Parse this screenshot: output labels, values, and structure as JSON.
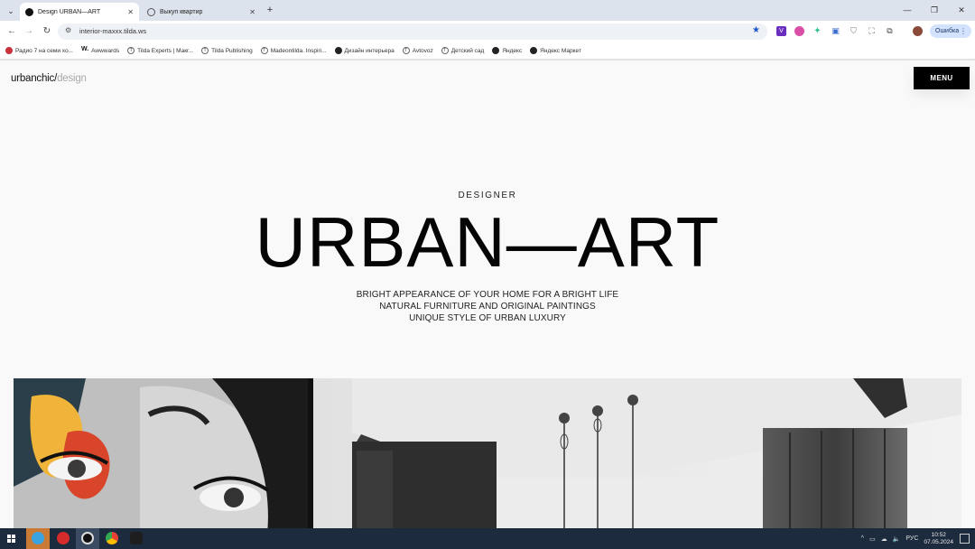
{
  "browser": {
    "tabs": [
      {
        "label": "Design URBAN—ART",
        "active": true
      },
      {
        "label": "Выкуп квартир",
        "active": false
      }
    ],
    "tab_list_icon": "chevron-down-icon",
    "new_tab_label": "+",
    "window_controls": {
      "minimize": "—",
      "restore": "❐",
      "close": "✕"
    },
    "nav": {
      "back": "←",
      "forward": "→",
      "reload": "↻"
    },
    "url": "interior-maxxx.tilda.ws",
    "error_label": "Ошибка",
    "bookmarks": [
      "Радио 7 на семи хо...",
      "Awwwards",
      "Tilda Experts | Макг...",
      "Tilda Publishing",
      "Madeontilda. Inspiri...",
      "Дизайн интерьера",
      "Avtovoz",
      "Детский сад",
      "Яндекс",
      "Яндекс Маркет"
    ]
  },
  "site": {
    "logo_main": "urbanchic/",
    "logo_sub": "design",
    "menu_label": "MENU",
    "eyebrow": "DESIGNER",
    "title": "URBAN—ART",
    "tagline": [
      "BRIGHT APPEARANCE OF YOUR HOME FOR A BRIGHT LIFE",
      "NATURAL FURNITURE AND ORIGINAL PAINTINGS",
      "UNIQUE STYLE OF URBAN LUXURY"
    ]
  },
  "taskbar": {
    "language": "РУС",
    "time": "10:52",
    "date": "07.05.2024"
  },
  "colors": {
    "menu_bg": "#000000",
    "page_bg": "#f9f9f9",
    "taskbar_bg": "#1c2b3d",
    "logo_sub": "#aaaaaa"
  }
}
